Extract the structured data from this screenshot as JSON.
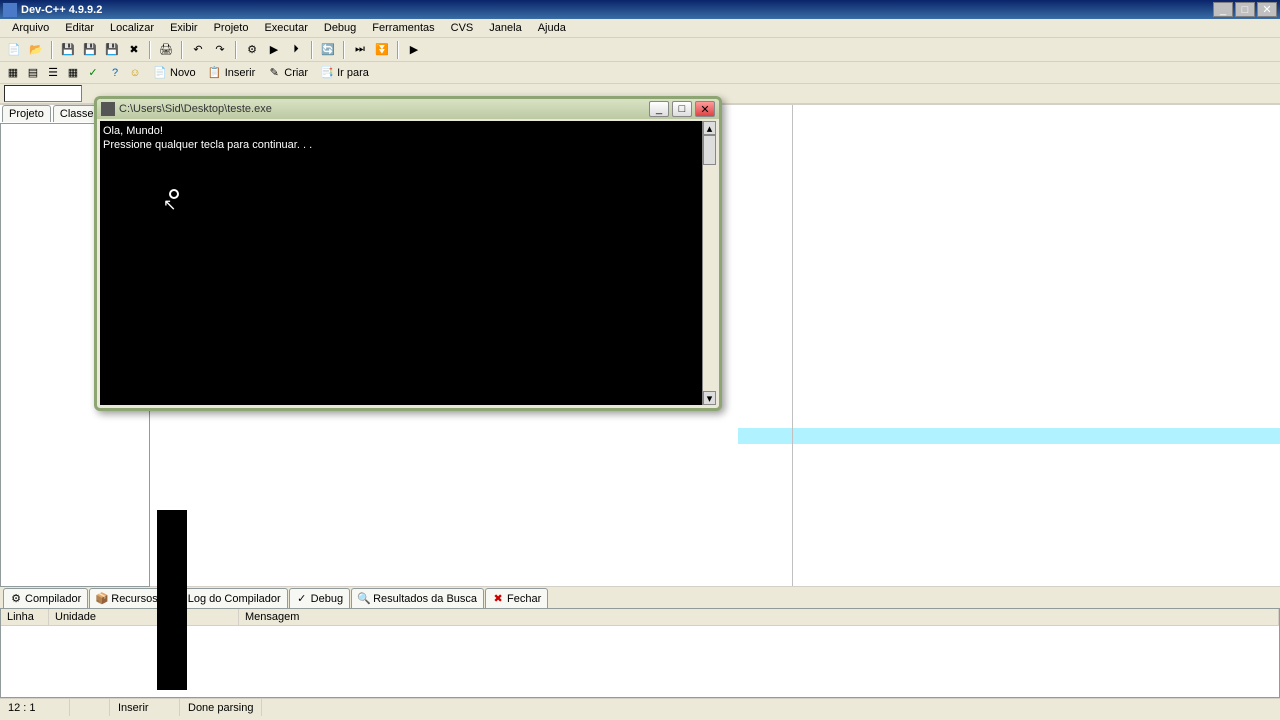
{
  "app": {
    "title": "Dev-C++ 4.9.9.2"
  },
  "menu": {
    "arquivo": "Arquivo",
    "editar": "Editar",
    "localizar": "Localizar",
    "exibir": "Exibir",
    "projeto": "Projeto",
    "executar": "Executar",
    "debug": "Debug",
    "ferramentas": "Ferramentas",
    "cvs": "CVS",
    "janela": "Janela",
    "ajuda": "Ajuda"
  },
  "tb2": {
    "novo": "Novo",
    "inserir": "Inserir",
    "criar": "Criar",
    "irpara": "Ir para"
  },
  "left_tabs": {
    "projeto": "Projeto",
    "classes": "Classes"
  },
  "bottom_tabs": {
    "compilador": "Compilador",
    "recursos": "Recursos",
    "logcomp": "Log do Compilador",
    "debug": "Debug",
    "resultados": "Resultados da Busca",
    "fechar": "Fechar"
  },
  "grid_headers": {
    "linha": "Linha",
    "unidade": "Unidade",
    "mensagem": "Mensagem"
  },
  "status": {
    "pos": "12 : 1",
    "mode": "Inserir",
    "msg": "Done parsing"
  },
  "console": {
    "title": "C:\\Users\\Sid\\Desktop\\teste.exe",
    "line1": "Ola, Mundo!",
    "line2": "Pressione qualquer tecla para continuar. . ."
  }
}
